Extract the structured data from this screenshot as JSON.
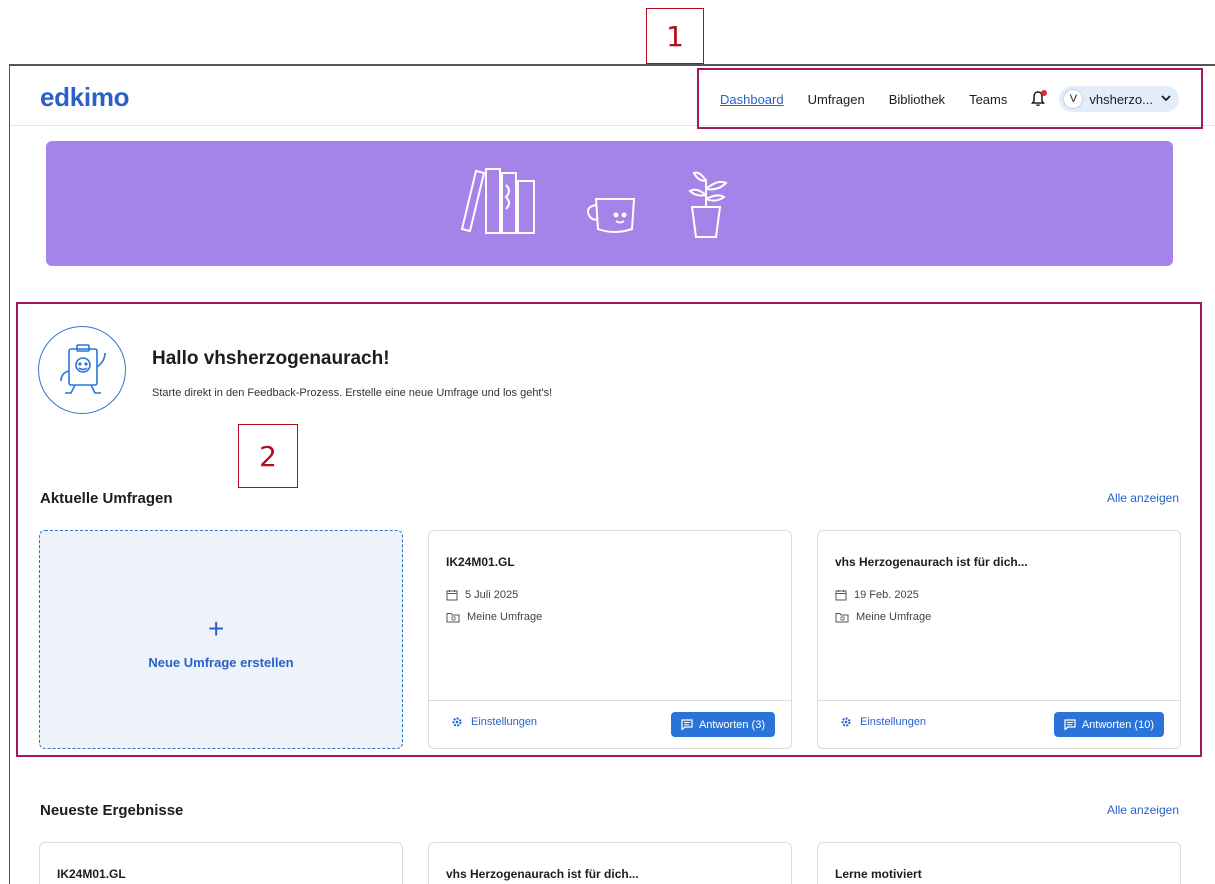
{
  "callouts": [
    "1",
    "2"
  ],
  "header": {
    "logo": "edkimo",
    "nav": [
      {
        "label": "Dashboard",
        "active": true
      },
      {
        "label": "Umfragen",
        "active": false
      },
      {
        "label": "Bibliothek",
        "active": false
      },
      {
        "label": "Teams",
        "active": false
      }
    ],
    "notification_icon": "bell-icon",
    "user": {
      "initial": "V",
      "name": "vhsherzo...",
      "chevron": "chevron-down-icon"
    }
  },
  "banner": {
    "illustration": "books-mug-plant-icon",
    "color": "#a583e8"
  },
  "welcome": {
    "title": "Hallo vhsherzogenaurach!",
    "subtitle": "Starte direkt in den Feedback-Prozess. Erstelle eine neue Umfrage und los geht's!",
    "icon": "clipboard-mascot-icon"
  },
  "current_surveys": {
    "title": "Aktuelle Umfragen",
    "see_all": "Alle anzeigen",
    "new_card": {
      "plus": "+",
      "label": "Neue Umfrage erstellen"
    },
    "cards": [
      {
        "title": "IK24M01.GL",
        "date": "5 Juli 2025",
        "folder": "Meine Umfrage",
        "settings": "Einstellungen",
        "answers": "Antworten (3)"
      },
      {
        "title": "vhs Herzogenaurach ist für dich...",
        "date": "19 Feb. 2025",
        "folder": "Meine Umfrage",
        "settings": "Einstellungen",
        "answers": "Antworten (10)"
      }
    ]
  },
  "latest_results": {
    "title": "Neueste Ergebnisse",
    "see_all": "Alle anzeigen",
    "cards": [
      {
        "title": "IK24M01.GL"
      },
      {
        "title": "vhs Herzogenaurach ist für dich..."
      },
      {
        "title": "Lerne motiviert"
      }
    ]
  },
  "colors": {
    "accent": "#2a61c9",
    "button": "#2a74d9",
    "highlight": "#a21a5e",
    "callout": "#b10f1f"
  }
}
